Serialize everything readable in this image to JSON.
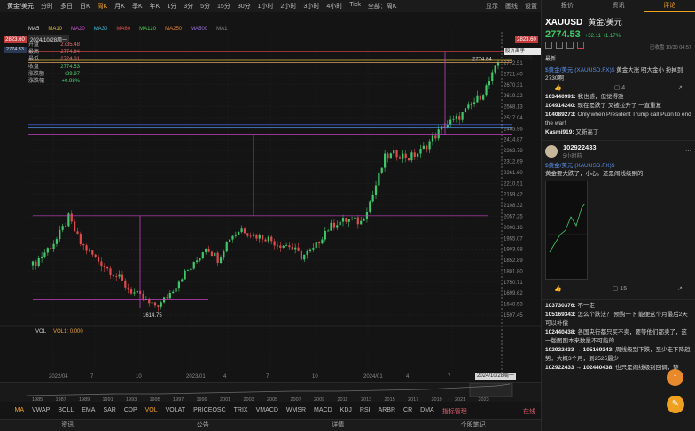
{
  "toolbar": {
    "symbol": "黄金/美元",
    "timeframes": [
      "分时",
      "多日",
      "日K",
      "周K",
      "月K",
      "季K",
      "年K",
      "1分",
      "3分",
      "5分",
      "15分",
      "30分",
      "1小时",
      "2小时",
      "3小时",
      "4小时",
      "Tick",
      "全部：周K"
    ],
    "active": "周K",
    "right": [
      "显示",
      "画线",
      "设置"
    ]
  },
  "ohlc": {
    "date": "2024/10/28周一",
    "rows": [
      {
        "k": "开盘",
        "v": "2735.48"
      },
      {
        "k": "最高",
        "v": "2774.84"
      },
      {
        "k": "最低",
        "v": "2724.81"
      },
      {
        "k": "收盘",
        "v": "2774.53"
      },
      {
        "k": "涨跌额",
        "v": "+39.97"
      },
      {
        "k": "涨跌幅",
        "v": "+0.98%"
      }
    ]
  },
  "ma_legend": [
    "MA5",
    "MA10",
    "MA20",
    "MA30",
    "MA60",
    "MA120",
    "MA250",
    "MA500",
    "MA1"
  ],
  "price_tags": {
    "left": "2823.60",
    "right": "2823.60",
    "last_left": "2774.53",
    "hover": "股价离手2823.60提醒",
    "hover2": "最新"
  },
  "y_axis": [
    "2772.51",
    "2721.40",
    "2670.31",
    "2619.22",
    "2568.13",
    "2517.04",
    "2465.96",
    "2414.87",
    "2363.78",
    "2312.69",
    "2261.60",
    "2210.51",
    "2159.42",
    "2108.32",
    "2057.25",
    "2006.16",
    "1955.07",
    "1903.98",
    "1852.89",
    "1801.80",
    "1750.71",
    "1699.62",
    "1648.53",
    "1597.45"
  ],
  "annotations": {
    "high": "2774.84",
    "low": "1614.75"
  },
  "vol": {
    "label": "VOL",
    "value": "VOL1: 0.000"
  },
  "x_axis": [
    "2022/04",
    "7",
    "10",
    "2023/01",
    "4",
    "7",
    "10",
    "2024/01",
    "4",
    "7"
  ],
  "date_cursor": "2024/10/28周一",
  "overview_years": [
    "1985",
    "1987",
    "1989",
    "1991",
    "1993",
    "1995",
    "1997",
    "1999",
    "2001",
    "2003",
    "2005",
    "2007",
    "2009",
    "2011",
    "2013",
    "2015",
    "2017",
    "2019",
    "2021",
    "2023"
  ],
  "indicators": [
    "MA",
    "VWAP",
    "BOLL",
    "EMA",
    "SAR",
    "CDP",
    "VOL",
    "VOLAT",
    "PRICEOSC",
    "TRIX",
    "VMACD",
    "WMSR",
    "MACD",
    "KDJ",
    "RSI",
    "ARBR",
    "CR",
    "DMA",
    "指标管理"
  ],
  "indicator_active": [
    "MA",
    "VOL"
  ],
  "indicator_right": "在线",
  "bottom_tabs": [
    "资讯",
    "公告",
    "详情",
    "个股笔记"
  ],
  "side": {
    "tabs": [
      "报价",
      "资讯",
      "评论"
    ],
    "active_tab": "评论",
    "code": "XAUUSD",
    "name": "黄金/美元",
    "price": "2774.53",
    "change": "+32.11 +1.17%",
    "status": "已收盘 10/30 04:57",
    "latest": "最新",
    "post1": {
      "link": "$黄金/美元 (XAUUSD.FX)$",
      "text": "黄金大涨 明大金小 扮掉到2730啊",
      "likes": "4"
    },
    "replies1": [
      {
        "u": "103440991:",
        "t": "我也感，但觉得雅"
      },
      {
        "u": "104914240:",
        "t": "现在是跌了 又被拉升了 一直重复"
      },
      {
        "u": "104089273:",
        "t": "Only when President Trump call Putin to end the war!"
      },
      {
        "u": "Kasmi919:",
        "t": "又新高了"
      }
    ],
    "post2": {
      "user": "102922433",
      "time": "5小时前",
      "link": "$黄金/美元 (XAUUSD.FX)$",
      "text": "黄金要大跌了，小心。还是闹线级别的"
    },
    "post2_stats": {
      "likes": "15"
    },
    "replies2": [
      {
        "u": "103730376:",
        "t": "不一定"
      },
      {
        "u": "105169343:",
        "t": "怎么个跌法？ 预购一下 能便这个月最后2天可以补偿"
      },
      {
        "u": "102440438:",
        "t": "各国央行都只买不卖，要等他们都卖了，这一版图图本来数量不可能的"
      },
      {
        "u": "102922433 → 105169343:",
        "t": "周线级别下跌，至少走下降趋势，大概3个月，到2525最少"
      },
      {
        "u": "102922433 → 102440438:",
        "t": "也只是闹线级别回调，整"
      }
    ]
  }
}
